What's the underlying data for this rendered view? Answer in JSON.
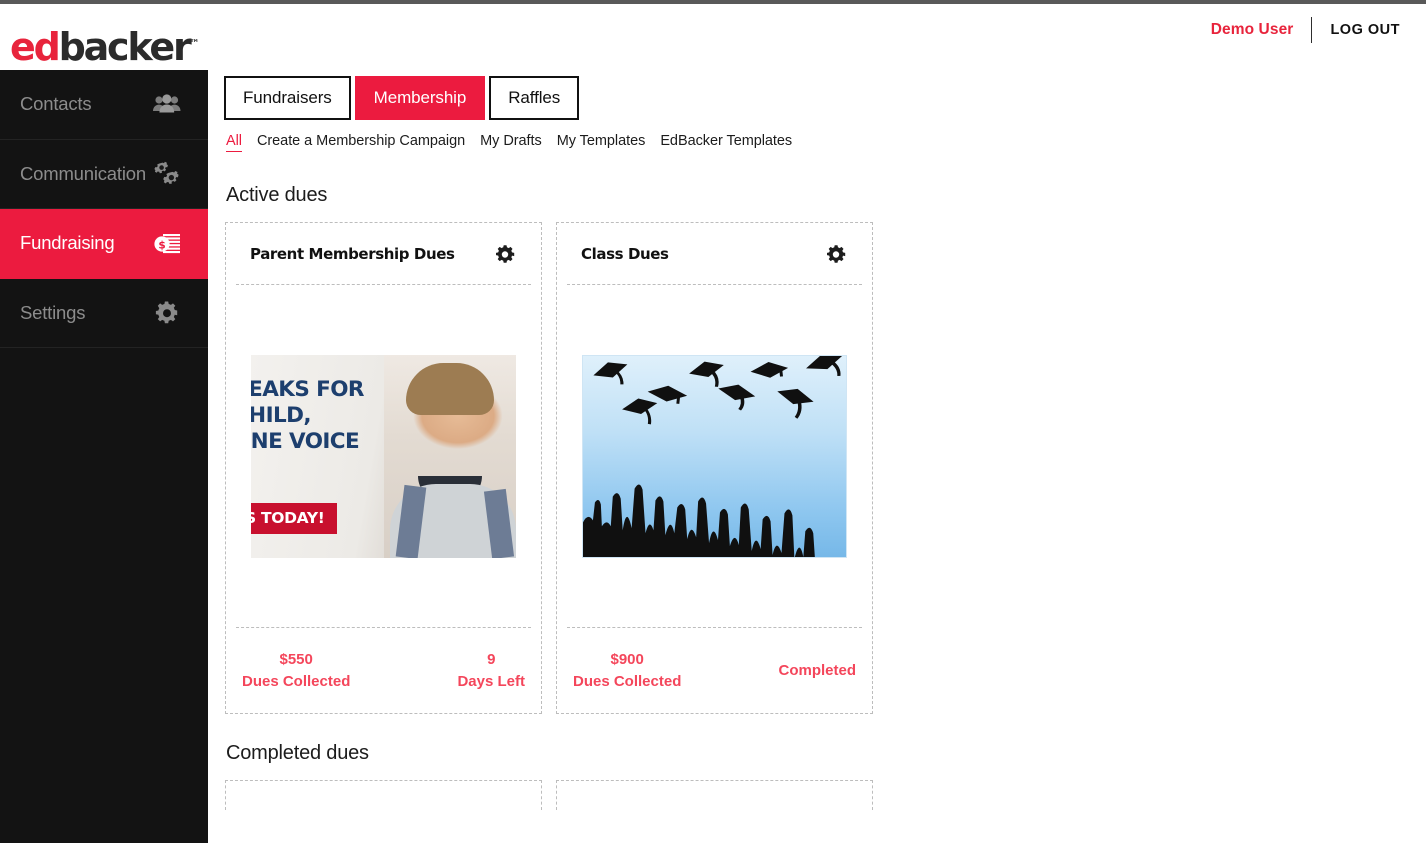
{
  "account": {
    "user_name": "Demo User",
    "logout_label": "LOG OUT"
  },
  "brand": {
    "logo_primary": "ed",
    "logo_secondary": "backer",
    "logo_tm": "™",
    "accent_color": "#ec1b3f",
    "accent_text_color": "#e8243c",
    "stat_color": "#f4465b"
  },
  "sidebar": {
    "items": [
      {
        "label": "Contacts",
        "icon": "people-icon",
        "active": false
      },
      {
        "label": "Communication",
        "icon": "gears-icon",
        "active": false
      },
      {
        "label": "Fundraising",
        "icon": "money-icon",
        "active": true
      },
      {
        "label": "Settings",
        "icon": "gear-icon",
        "active": false
      }
    ]
  },
  "tabs": [
    {
      "label": "Fundraisers",
      "active": false
    },
    {
      "label": "Membership",
      "active": true
    },
    {
      "label": "Raffles",
      "active": false
    }
  ],
  "subnav": [
    {
      "label": "All",
      "active": true
    },
    {
      "label": "Create a Membership Campaign",
      "active": false
    },
    {
      "label": "My Drafts",
      "active": false
    },
    {
      "label": "My Templates",
      "active": false
    },
    {
      "label": "EdBacker Templates",
      "active": false
    }
  ],
  "sections": {
    "active_dues_title": "Active dues",
    "completed_dues_title": "Completed dues"
  },
  "cards": [
    {
      "title": "Parent Membership Dues",
      "gear_icon": "gear-icon",
      "thumbnail": "pta-banner-image",
      "thumbnail_text_line1": "PEAKS FOR",
      "thumbnail_text_line2": "CHILD,",
      "thumbnail_text_line3": "ONE VOICE",
      "thumbnail_cta": "S TODAY!",
      "stat_left_value": "$550",
      "stat_left_label": "Dues Collected",
      "stat_right_value": "9",
      "stat_right_label": "Days Left"
    },
    {
      "title": "Class Dues",
      "gear_icon": "gear-icon",
      "thumbnail": "graduation-caps-image",
      "stat_left_value": "$900",
      "stat_left_label": "Dues Collected",
      "stat_right_value": "",
      "stat_right_label": "Completed"
    }
  ]
}
